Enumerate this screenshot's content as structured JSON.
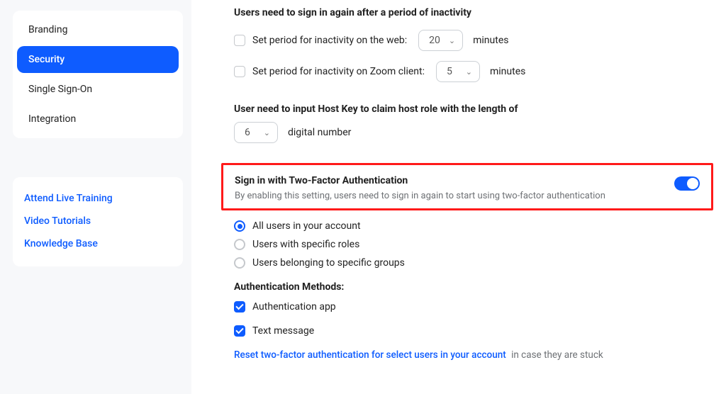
{
  "sidebar": {
    "items": [
      {
        "label": "Branding"
      },
      {
        "label": "Security"
      },
      {
        "label": "Single Sign-On"
      },
      {
        "label": "Integration"
      }
    ],
    "help": [
      {
        "label": "Attend Live Training"
      },
      {
        "label": "Video Tutorials"
      },
      {
        "label": "Knowledge Base"
      }
    ]
  },
  "inactivity": {
    "heading": "Users need to sign in again after a period of inactivity",
    "web_label": "Set period for inactivity on the web:",
    "web_value": "20",
    "web_unit": "minutes",
    "client_label": "Set period for inactivity on Zoom client:",
    "client_value": "5",
    "client_unit": "minutes"
  },
  "hostkey": {
    "heading": "User need to input Host Key to claim host role with the length of",
    "value": "6",
    "unit": "digital number"
  },
  "tfa": {
    "title": "Sign in with Two-Factor Authentication",
    "desc": "By enabling this setting, users need to sign in again to start using two-factor authentication",
    "scope": {
      "all": "All users in your account",
      "roles": "Users with specific roles",
      "groups": "Users belonging to specific groups"
    },
    "methods_heading": "Authentication Methods:",
    "methods": {
      "app": "Authentication app",
      "sms": "Text message"
    },
    "reset_link": "Reset two-factor authentication for select users in your account",
    "reset_suffix": "in case they are stuck"
  }
}
